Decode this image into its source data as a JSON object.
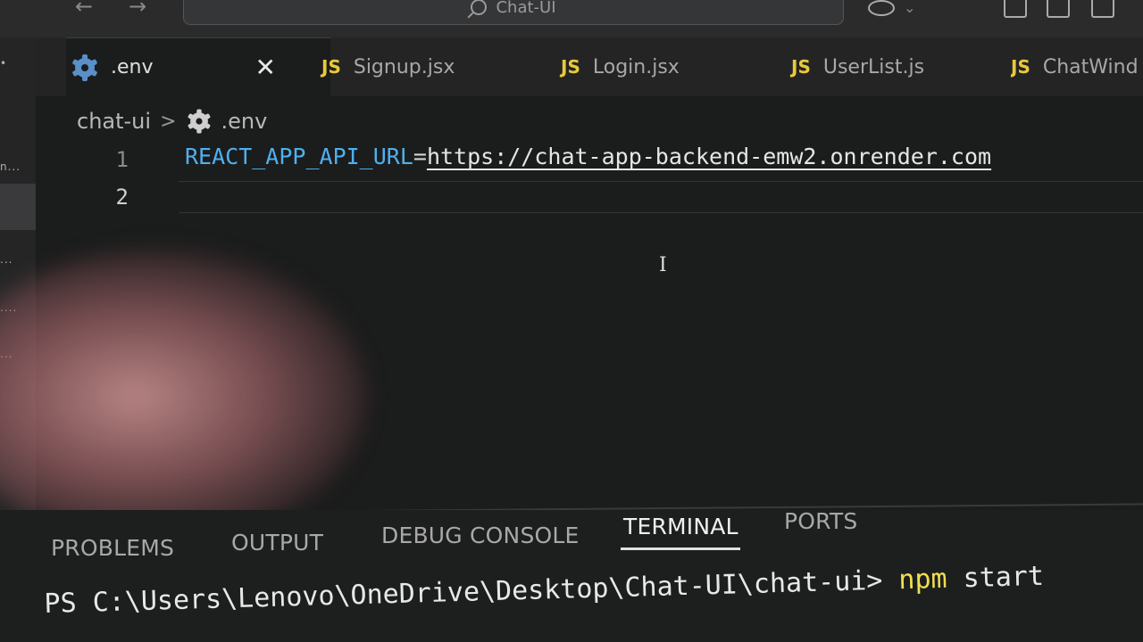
{
  "window": {
    "title": "Chat-UI"
  },
  "tabs": [
    {
      "label": ".env",
      "icon": "gear-icon",
      "active": true
    },
    {
      "label": "Signup.jsx",
      "icon": "js-icon",
      "active": false
    },
    {
      "label": "Login.jsx",
      "icon": "js-icon",
      "active": false
    },
    {
      "label": "UserList.js",
      "icon": "js-icon",
      "active": false
    },
    {
      "label": "ChatWind",
      "icon": "js-icon",
      "active": false
    }
  ],
  "js_badge": "JS",
  "close_glyph": "✕",
  "breadcrumb": {
    "folder": "chat-ui",
    "separator": ">",
    "file": ".env"
  },
  "editor": {
    "lines": [
      {
        "number": "1",
        "key": "REACT_APP_API_URL",
        "eq": "=",
        "value": "https://chat-app-backend-emw2.onrender.com"
      },
      {
        "number": "2",
        "key": "",
        "eq": "",
        "value": ""
      }
    ]
  },
  "panel": {
    "tabs": [
      "PROBLEMS",
      "OUTPUT",
      "DEBUG CONSOLE",
      "TERMINAL",
      "PORTS"
    ],
    "active_tab": "TERMINAL"
  },
  "terminal": {
    "prompt": "PS C:\\Users\\Lenovo\\OneDrive\\Desktop\\Chat-UI\\chat-ui>",
    "command": "npm",
    "args": "start"
  },
  "colors": {
    "env_key": "#4fb0ef",
    "js_badge": "#e8c93a",
    "terminal_command": "#f0e050"
  }
}
